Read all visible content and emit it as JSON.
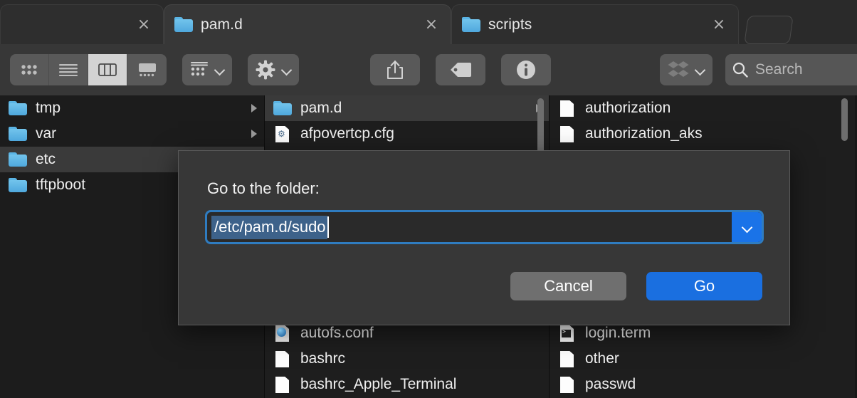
{
  "window": {
    "tabs": [
      {
        "label": "",
        "icon": "",
        "active": false,
        "close_label": "×"
      },
      {
        "label": "pam.d",
        "icon": "folder-icon",
        "active": true,
        "close_label": "×"
      },
      {
        "label": "scripts",
        "icon": "folder-icon",
        "active": false,
        "close_label": "×"
      }
    ],
    "new_tab_label": ""
  },
  "toolbar": {
    "view_modes": [
      {
        "name": "icon-view",
        "selected": false
      },
      {
        "name": "list-view",
        "selected": false
      },
      {
        "name": "column-view",
        "selected": true
      },
      {
        "name": "gallery-view",
        "selected": false
      }
    ],
    "group_button": "group-by-icon",
    "action_button": "gear-icon",
    "share_button": "share-icon",
    "tag_button": "tag-icon",
    "info_button": "info-icon",
    "dropbox_button": "dropbox-icon",
    "search": {
      "placeholder": "Search",
      "value": "",
      "icon": "search-icon"
    }
  },
  "columns": [
    {
      "name": "column-root",
      "rows": [
        {
          "label": "tmp",
          "icon": "folder-icon",
          "has_children": true,
          "selected": false
        },
        {
          "label": "var",
          "icon": "folder-icon",
          "has_children": true,
          "selected": false
        },
        {
          "label": "etc",
          "icon": "folder-icon",
          "has_children": false,
          "selected": true
        },
        {
          "label": "tftpboot",
          "icon": "folder-icon",
          "has_children": false,
          "selected": false
        }
      ]
    },
    {
      "name": "column-etc",
      "rows": [
        {
          "label": "pam.d",
          "icon": "folder-icon",
          "has_children": true,
          "selected": true
        },
        {
          "label": "afpovertcp.cfg",
          "icon": "config-file-icon",
          "has_children": false,
          "selected": false
        },
        {
          "label": "autofs.conf",
          "icon": "web-file-icon",
          "has_children": false,
          "selected": false
        },
        {
          "label": "bashrc",
          "icon": "document-icon",
          "has_children": false,
          "selected": false
        },
        {
          "label": "bashrc_Apple_Terminal",
          "icon": "document-icon",
          "has_children": false,
          "selected": false
        }
      ]
    },
    {
      "name": "column-pamd",
      "rows": [
        {
          "label": "authorization",
          "icon": "document-icon",
          "has_children": false,
          "selected": false
        },
        {
          "label": "authorization_aks",
          "icon": "document-icon",
          "has_children": false,
          "selected": false
        },
        {
          "label": "login.term",
          "icon": "terminal-file-icon",
          "has_children": false,
          "selected": false
        },
        {
          "label": "other",
          "icon": "document-icon",
          "has_children": false,
          "selected": false
        },
        {
          "label": "passwd",
          "icon": "document-icon",
          "has_children": false,
          "selected": false
        }
      ]
    }
  ],
  "dialog": {
    "title": "Go to the folder:",
    "path_value": "/etc/pam.d/sudo",
    "path_placeholder": "",
    "dropdown_icon": "chevron-down-icon",
    "cancel_label": "Cancel",
    "go_label": "Go"
  },
  "colors": {
    "accent": "#1a6fe0",
    "selection": "#3d628a",
    "field_border": "#2f7cc0",
    "folder": "#5ab4e4",
    "toolbar_bg": "#373737",
    "dialog_bg": "#373737"
  }
}
